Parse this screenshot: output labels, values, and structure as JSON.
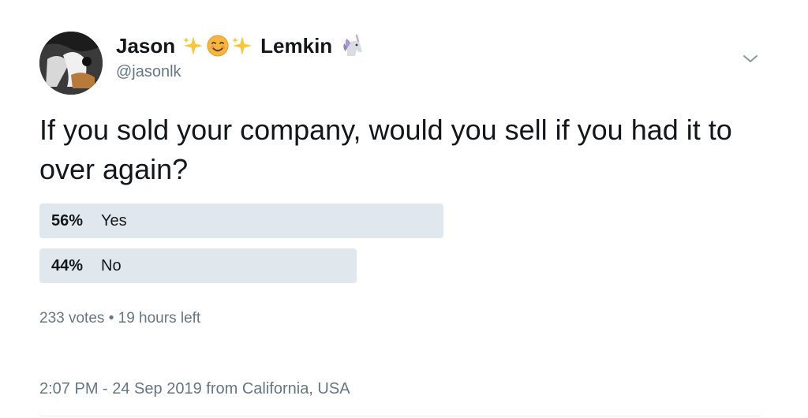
{
  "author": {
    "name_first": "Jason",
    "name_last": "Lemkin",
    "handle": "@jasonlk",
    "name_emojis": [
      "sparkles-icon",
      "smiling-face-icon",
      "sparkles-icon",
      "unicorn-icon"
    ]
  },
  "tweet": {
    "text": "If you sold your company, would you sell if you had it to over again?"
  },
  "poll": {
    "options": [
      {
        "percent": "56%",
        "label": "Yes",
        "share": 0.56
      },
      {
        "percent": "44%",
        "label": "No",
        "share": 0.44
      }
    ],
    "votes": "233 votes",
    "separator": "•",
    "time_left": "19 hours left"
  },
  "meta": {
    "time": "2:07 PM - 24 Sep 2019",
    "from_word": "from",
    "place": "California, USA"
  },
  "colors": {
    "text": "#14171a",
    "secondary": "#657786",
    "poll_bar": "#e1e8ed"
  }
}
